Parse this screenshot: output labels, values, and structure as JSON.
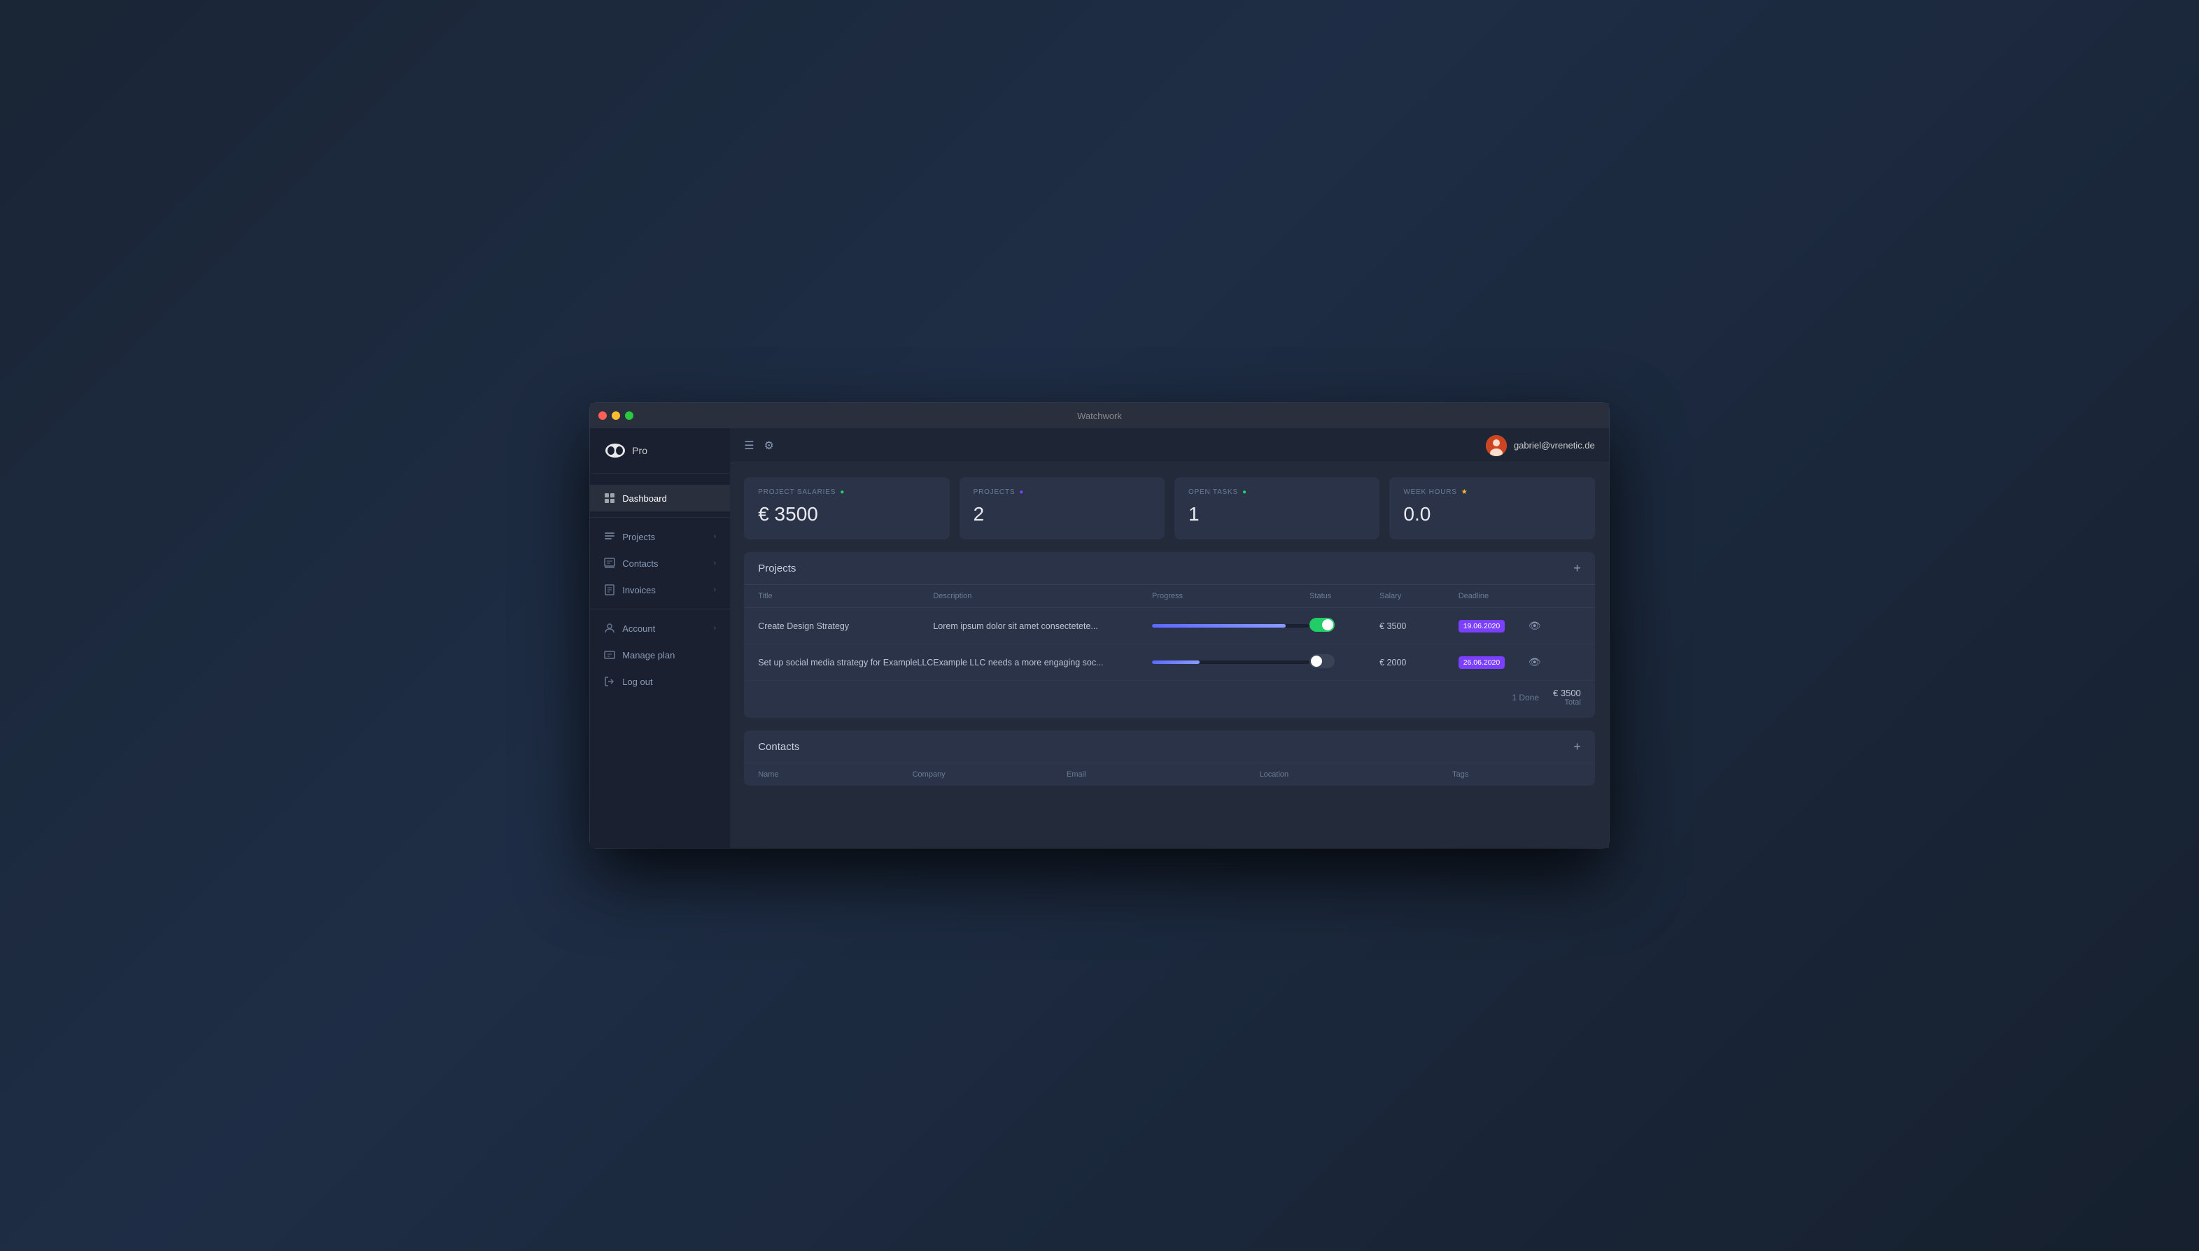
{
  "window": {
    "title": "Watchwork"
  },
  "app": {
    "logo_text": "Pro"
  },
  "sidebar": {
    "items": [
      {
        "id": "dashboard",
        "label": "Dashboard",
        "icon": "dashboard",
        "has_chevron": false,
        "active": true
      },
      {
        "id": "projects",
        "label": "Projects",
        "icon": "projects",
        "has_chevron": true,
        "active": false
      },
      {
        "id": "contacts",
        "label": "Contacts",
        "icon": "contacts",
        "has_chevron": true,
        "active": false
      },
      {
        "id": "invoices",
        "label": "Invoices",
        "icon": "invoices",
        "has_chevron": true,
        "active": false
      },
      {
        "id": "account",
        "label": "Account",
        "icon": "account",
        "has_chevron": true,
        "active": false
      },
      {
        "id": "manage-plan",
        "label": "Manage plan",
        "icon": "manage",
        "has_chevron": false,
        "active": false
      },
      {
        "id": "log-out",
        "label": "Log out",
        "icon": "logout",
        "has_chevron": false,
        "active": false
      }
    ]
  },
  "header": {
    "user_email": "gabriel@vrenetic.de"
  },
  "stats": [
    {
      "id": "project-salaries",
      "label": "PROJECT SALARIES",
      "value": "€ 3500",
      "icon": "💚"
    },
    {
      "id": "projects",
      "label": "PROJECTS",
      "value": "2",
      "icon": "📋"
    },
    {
      "id": "open-tasks",
      "label": "OPEN TASKS",
      "value": "1",
      "icon": "📋"
    },
    {
      "id": "week-hours",
      "label": "WEEK HOURS",
      "value": "0.0",
      "icon": "⭐"
    }
  ],
  "projects_section": {
    "title": "Projects",
    "add_btn": "+",
    "columns": [
      "Title",
      "Description",
      "Progress",
      "Status",
      "Salary",
      "Deadline",
      ""
    ],
    "rows": [
      {
        "title": "Create Design Strategy",
        "description": "Lorem ipsum dolor sit amet consectetete...",
        "progress": 85,
        "status_on": true,
        "salary": "€ 3500",
        "deadline": "19.06.2020"
      },
      {
        "title": "Set up social media strategy for ExampleLLC",
        "description": "Example LLC needs a more engaging soc...",
        "progress": 30,
        "status_on": false,
        "salary": "€ 2000",
        "deadline": "26.06.2020"
      }
    ],
    "footer": {
      "done_label": "1 Done",
      "total_amount": "€ 3500",
      "total_label": "Total"
    }
  },
  "contacts_section": {
    "title": "Contacts",
    "add_btn": "+",
    "columns": [
      "Name",
      "Company",
      "Email",
      "Location",
      "Tags"
    ]
  }
}
